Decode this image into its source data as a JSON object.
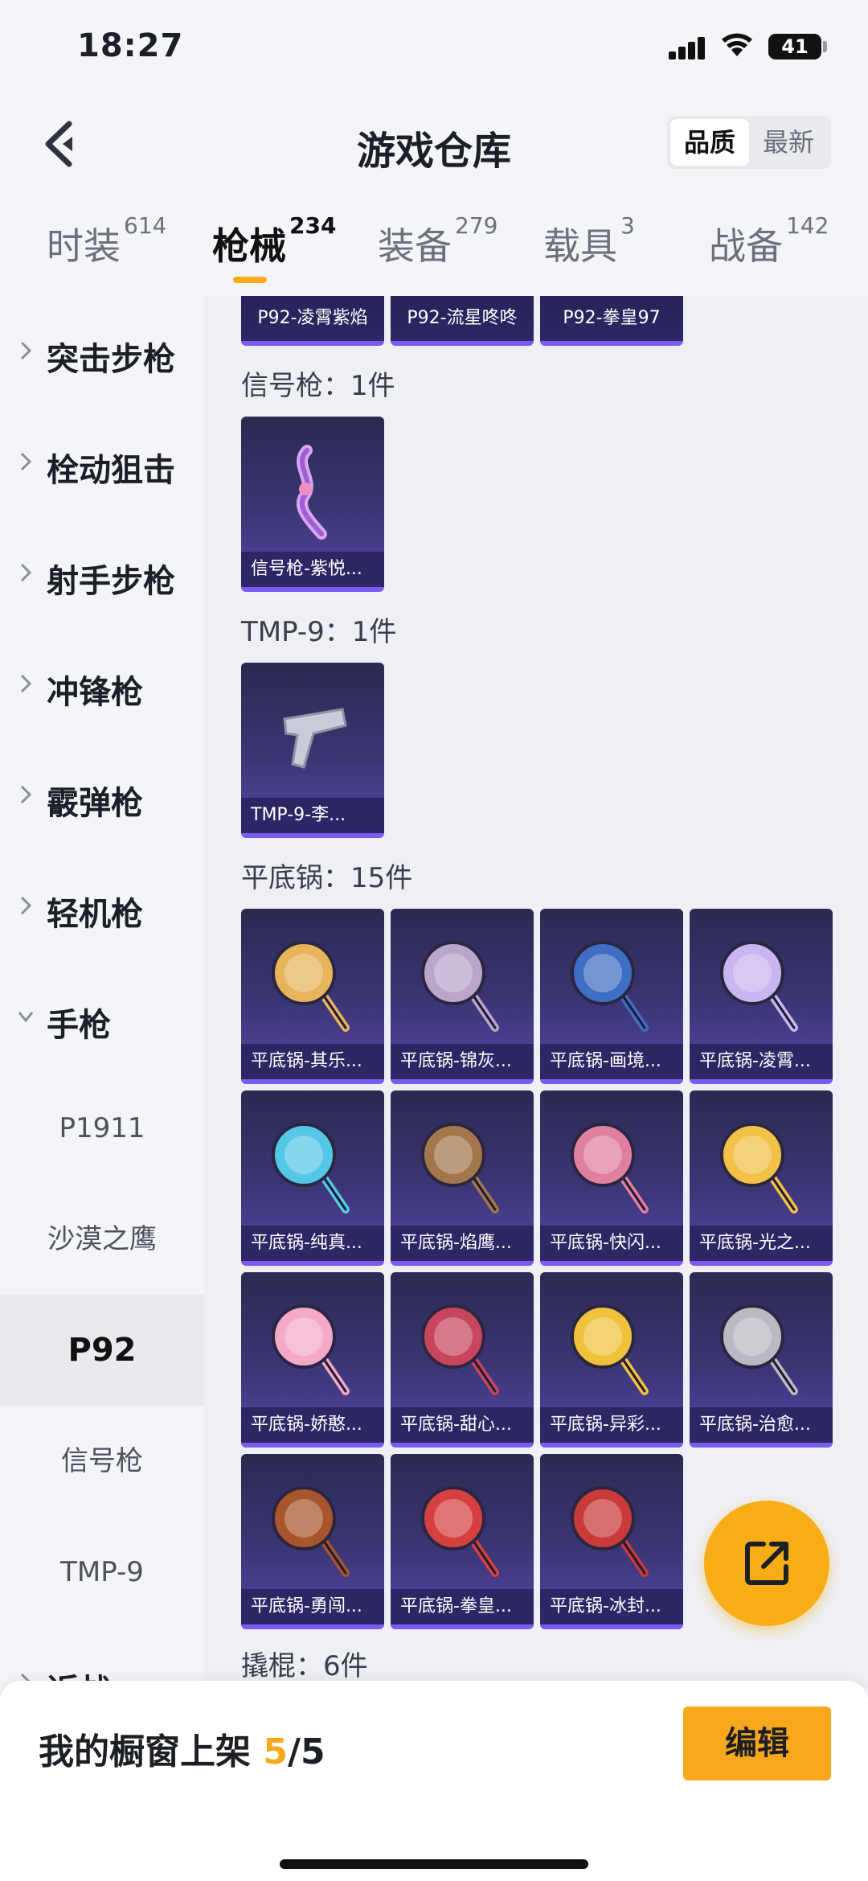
{
  "status": {
    "time": "18:27",
    "battery": "41"
  },
  "header": {
    "title": "游戏仓库",
    "sort_quality": "品质",
    "sort_newest": "最新"
  },
  "tabs": [
    {
      "label": "时装",
      "count": "614"
    },
    {
      "label": "枪械",
      "count": "234"
    },
    {
      "label": "装备",
      "count": "279"
    },
    {
      "label": "载具",
      "count": "3"
    },
    {
      "label": "战备",
      "count": "142"
    }
  ],
  "sidebar": {
    "categories": [
      "突击步枪",
      "栓动狙击",
      "射手步枪",
      "冲锋枪",
      "霰弹枪",
      "轻机枪",
      "手枪"
    ],
    "pistols": [
      "P1911",
      "沙漠之鹰",
      "P92",
      "信号枪",
      "TMP-9"
    ],
    "next_partial": "近战"
  },
  "content": {
    "p92_items": [
      "P92-凌霄紫焰",
      "P92-流星咚咚",
      "P92-拳皇97"
    ],
    "flare_title": "信号枪：1件",
    "flare_items": [
      "信号枪-紫悦..."
    ],
    "tmp_title": "TMP-9：1件",
    "tmp_items": [
      "TMP-9-李..."
    ],
    "pan_title": "平底锅：15件",
    "pan_items": [
      "平底锅-其乐...",
      "平底锅-锦灰...",
      "平底锅-画境...",
      "平底锅-凌霄...",
      "平底锅-纯真...",
      "平底锅-焰鹰...",
      "平底锅-快闪...",
      "平底锅-光之...",
      "平底锅-娇憨...",
      "平底锅-甜心...",
      "平底锅-异彩...",
      "平底锅-治愈...",
      "平底锅-勇闯...",
      "平底锅-拳皇...",
      "平底锅-冰封..."
    ],
    "crowbar_title": "撬棍：6件"
  },
  "pan_colors": [
    "#e7b45a",
    "#b9a6c9",
    "#3f6fc4",
    "#c9b5f0",
    "#55c7e6",
    "#a4764c",
    "#e07fa0",
    "#f2c146",
    "#f4a9c8",
    "#c7465e",
    "#f0c23c",
    "#b9b9c3",
    "#a8552b",
    "#d64040",
    "#c93a3a"
  ],
  "bottom": {
    "label": "我的橱窗上架",
    "count": "5",
    "total": "/5",
    "edit": "编辑"
  },
  "colors": {
    "accent": "#f7a81b",
    "card_top": "#2b2a52",
    "card_bottom": "#5647a8"
  }
}
